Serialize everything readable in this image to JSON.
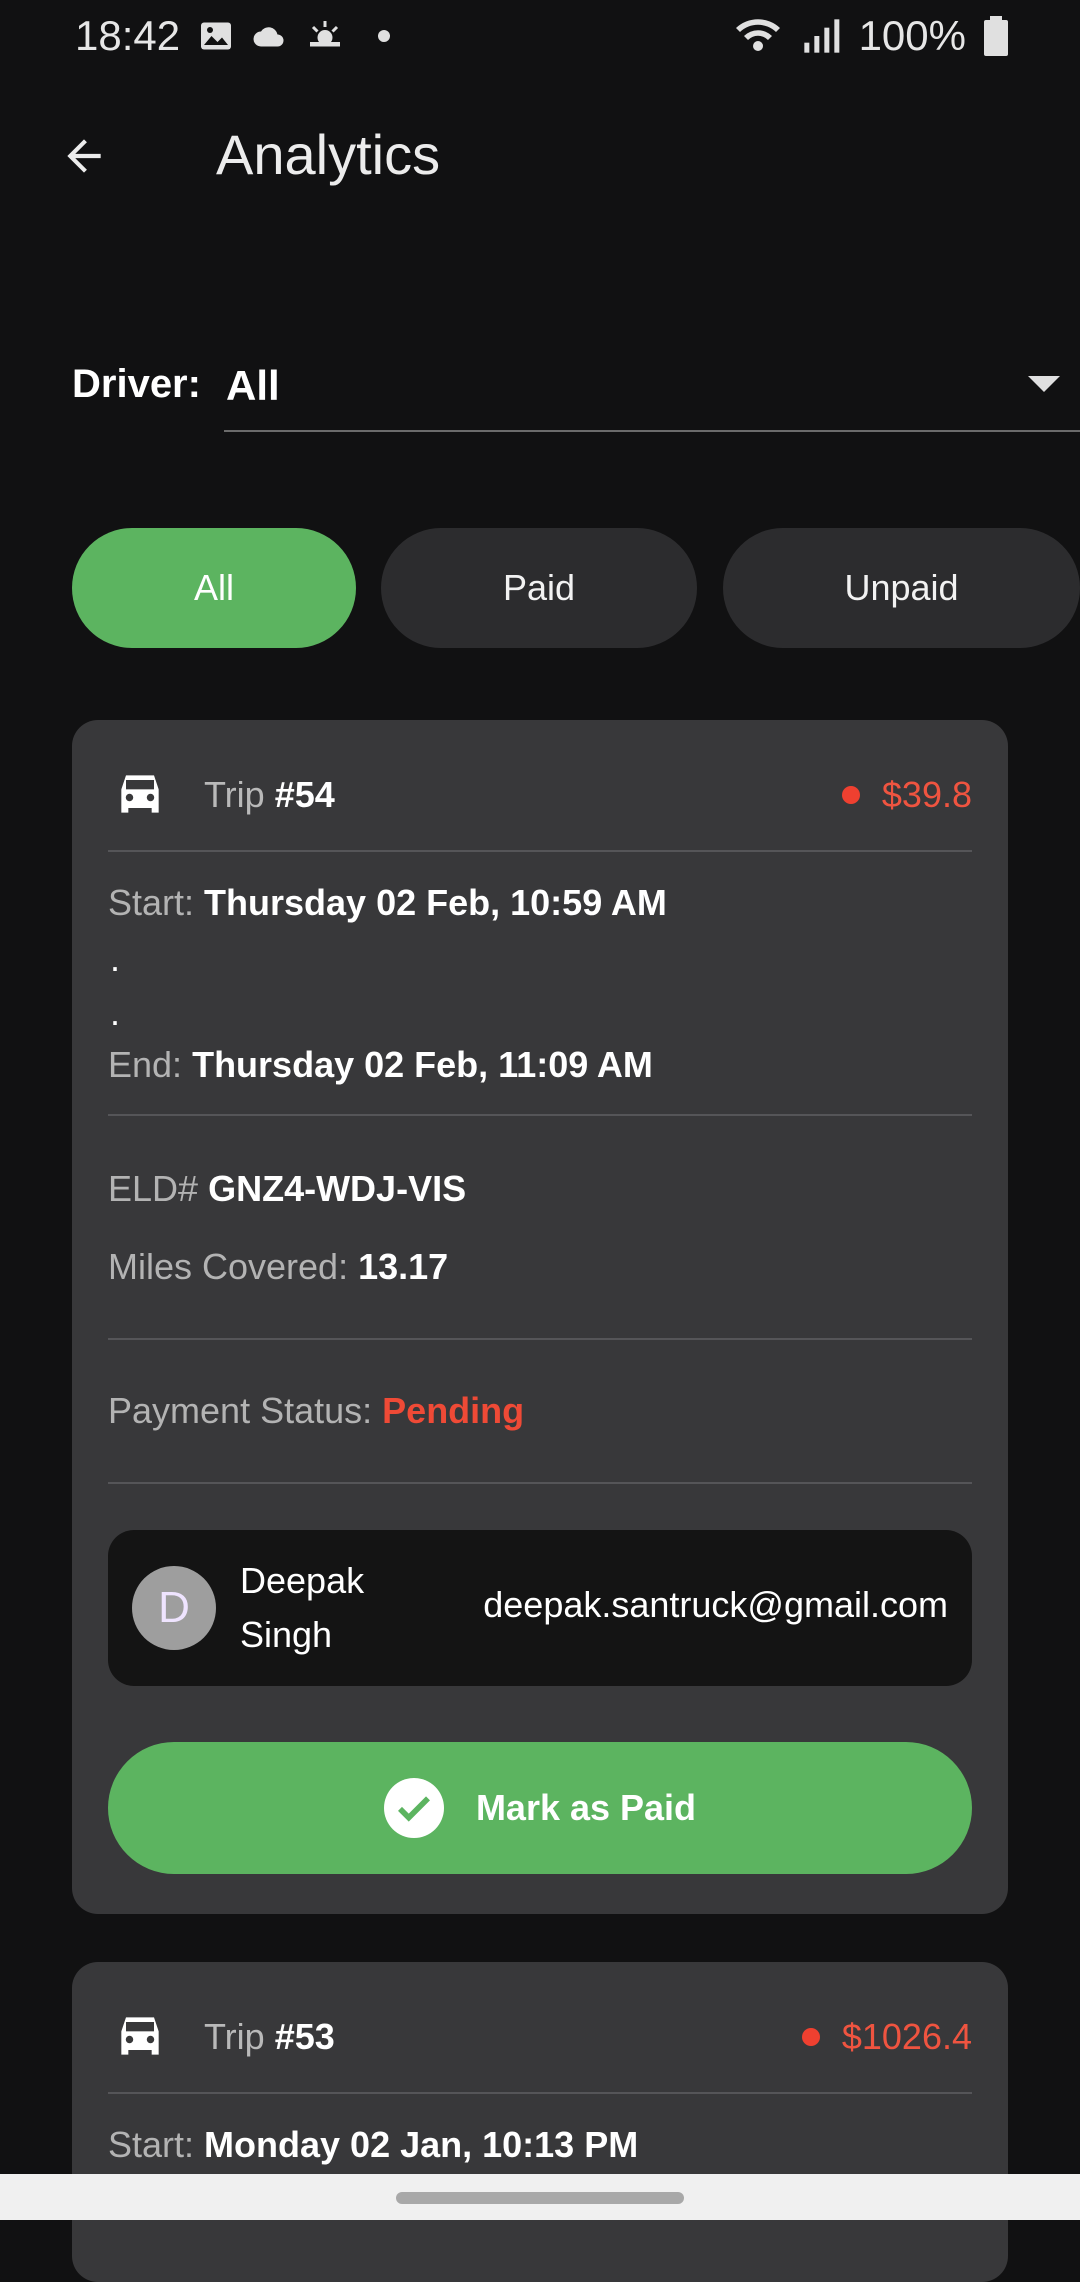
{
  "status_bar": {
    "time": "18:42",
    "battery": "100%",
    "icons": [
      "image-icon",
      "cloud-icon",
      "weather-icon",
      "dot-icon",
      "wifi-icon",
      "signal-icon",
      "battery-icon"
    ]
  },
  "app_bar": {
    "title": "Analytics",
    "back_icon": "arrow-left-icon"
  },
  "driver_filter": {
    "label": "Driver:",
    "value": "All"
  },
  "filters": {
    "tabs": [
      {
        "label": "All",
        "active": true
      },
      {
        "label": "Paid",
        "active": false
      },
      {
        "label": "Unpaid",
        "active": false
      }
    ]
  },
  "trips": [
    {
      "trip_prefix": "Trip",
      "trip_number": "#54",
      "amount": "$39.8",
      "start_label": "Start:",
      "start": "Thursday 02 Feb, 10:59 AM",
      "dot": ".",
      "end_label": "End:",
      "end": "Thursday 02 Feb, 11:09 AM",
      "eld_label": "ELD#",
      "eld": "GNZ4-WDJ-VIS",
      "miles_label": "Miles Covered:",
      "miles": "13.17",
      "payment_label": "Payment Status:",
      "payment_status": "Pending",
      "driver": {
        "initial": "D",
        "name": "Deepak Singh",
        "email": "deepak.santruck@gmail.com"
      },
      "action_label": "Mark as Paid"
    },
    {
      "trip_prefix": "Trip",
      "trip_number": "#53",
      "amount": "$1026.4",
      "start_label": "Start:",
      "start": "Monday 02 Jan, 10:13 PM"
    }
  ],
  "colors": {
    "accent_green": "#5cb460",
    "pending_red": "#ef4a36",
    "card_bg": "#38383a",
    "background": "#111112"
  }
}
